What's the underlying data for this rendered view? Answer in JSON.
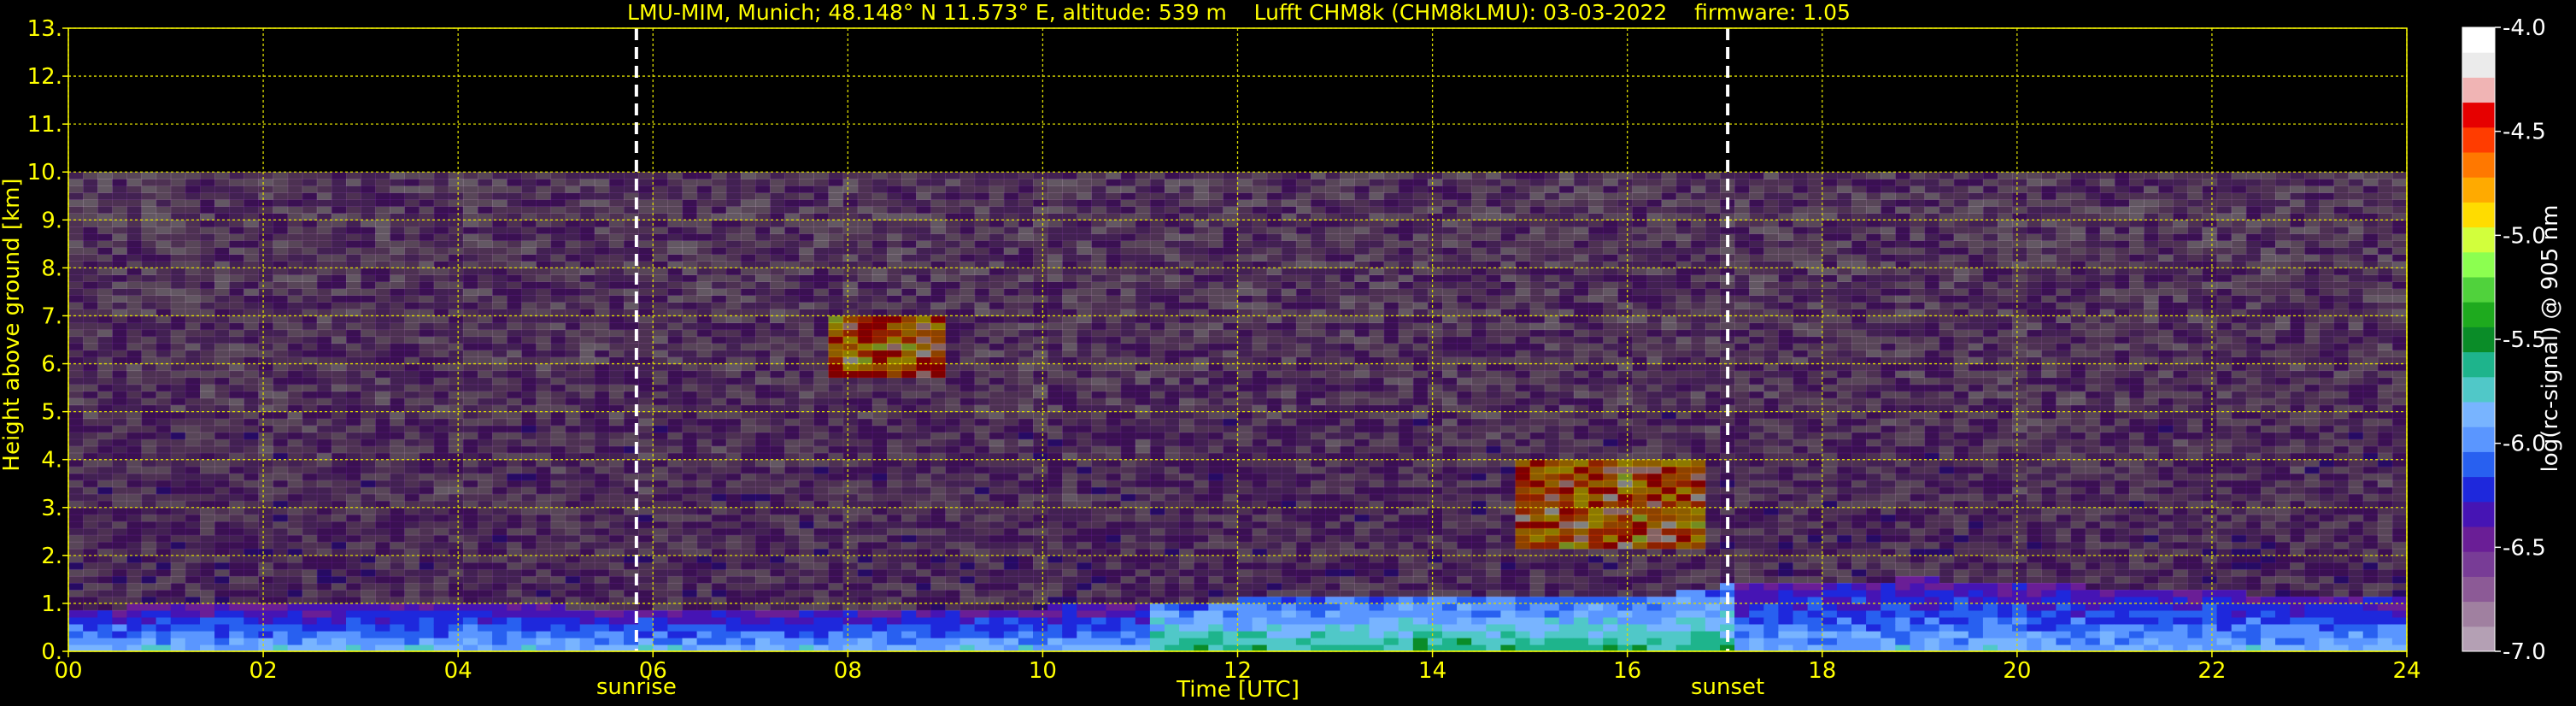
{
  "chart_data": {
    "type": "heatmap",
    "title": "LMU-MIM, Munich; 48.148° N 11.573° E, altitude: 539 m    Lufft CHM8k (CHM8kLMU): 03-03-2022    firmware: 1.05",
    "xlabel": "Time [UTC]",
    "ylabel": "Height above ground [km]",
    "xlim": [
      0,
      24
    ],
    "ylim": [
      0,
      13
    ],
    "x_ticks": [
      "00",
      "02",
      "04",
      "06",
      "08",
      "10",
      "12",
      "14",
      "16",
      "18",
      "20",
      "22",
      "24"
    ],
    "y_ticks": [
      "0.",
      "1.",
      "2.",
      "3.",
      "4.",
      "5.",
      "6.",
      "7.",
      "8.",
      "9.",
      "10.",
      "11.",
      "12.",
      "13."
    ],
    "grid": true,
    "data_top_km": 10,
    "events": [
      {
        "label": "sunrise",
        "time": 5.83
      },
      {
        "label": "sunset",
        "time": 17.03
      }
    ],
    "features": {
      "boundary_layer": [
        {
          "time": 0,
          "top": 0.85
        },
        {
          "time": 4,
          "top": 0.9
        },
        {
          "time": 8,
          "top": 0.75
        },
        {
          "time": 10,
          "top": 0.85
        },
        {
          "time": 12,
          "top": 1.0
        },
        {
          "time": 14,
          "top": 1.05
        },
        {
          "time": 16,
          "top": 1.0
        },
        {
          "time": 17,
          "top": 1.3
        },
        {
          "time": 19,
          "top": 1.45
        },
        {
          "time": 21,
          "top": 1.25
        },
        {
          "time": 24,
          "top": 1.0
        }
      ],
      "clouds": [
        {
          "t0": 7.8,
          "t1": 8.9,
          "z0": 5.7,
          "z1": 7.0
        },
        {
          "t0": 14.8,
          "t1": 16.7,
          "z0": 2.1,
          "z1": 4.0
        }
      ]
    },
    "colorbar": {
      "label": "log(rc-signal) @ 905 nm",
      "range": [
        -7.0,
        -4.0
      ],
      "ticks": [
        "-4.0",
        "-4.5",
        "-5.0",
        "-5.5",
        "-6.0",
        "-6.5",
        "-7.0"
      ],
      "tick_values": [
        -4.0,
        -4.5,
        -5.0,
        -5.5,
        -6.0,
        -6.5,
        -7.0
      ],
      "colors": [
        "#b4a0b4",
        "#a080a0",
        "#8c5a96",
        "#783c96",
        "#6a1e96",
        "#4614b4",
        "#1e28dc",
        "#2860f0",
        "#5a96ff",
        "#78b4ff",
        "#50c8c8",
        "#1eb48c",
        "#0a8c28",
        "#1eaa1e",
        "#50d23c",
        "#8cff50",
        "#d2ff3c",
        "#ffdc00",
        "#ffaa00",
        "#ff7800",
        "#ff3c00",
        "#e60000",
        "#f0b4b4",
        "#ebebeb",
        "#ffffff"
      ]
    },
    "colors": {
      "text": "#ffff00",
      "grid": "#dcdc00",
      "event_line": "#ffffff",
      "background": "#000000"
    }
  }
}
